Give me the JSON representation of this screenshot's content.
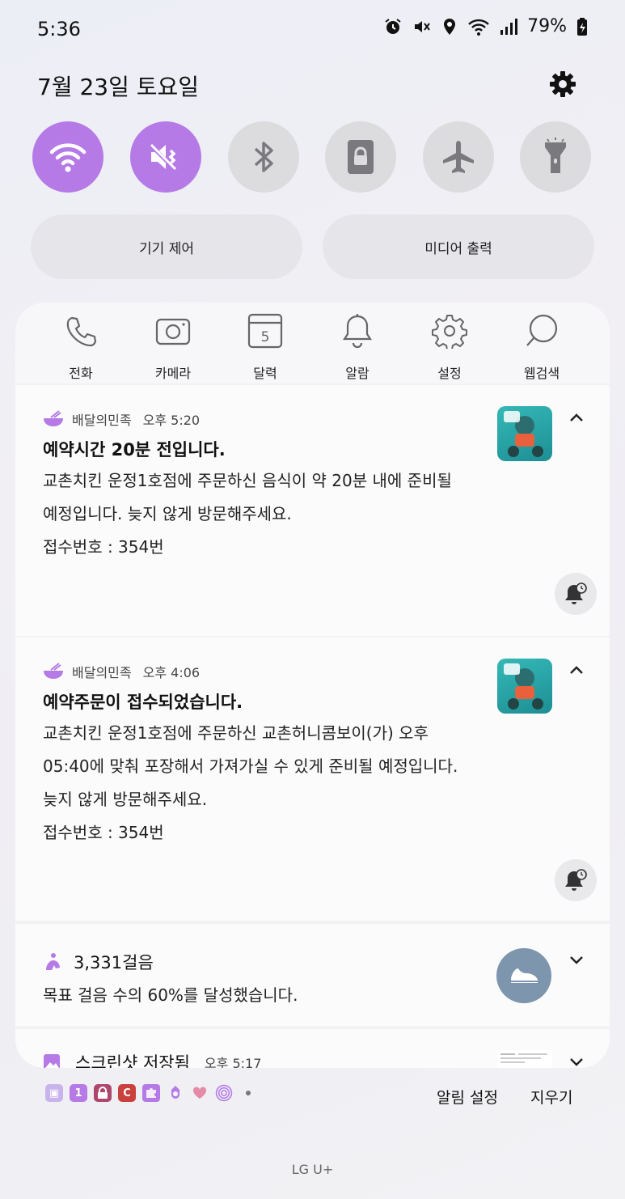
{
  "status_bar": {
    "time": "5:36",
    "battery": "79%",
    "icons": [
      "alarm-icon",
      "mute-icon",
      "location-icon",
      "wifi-icon",
      "signal-icon",
      "battery-icon"
    ]
  },
  "header": {
    "date": "7월 23일 토요일"
  },
  "quick_toggles": [
    {
      "name": "wifi",
      "icon": "wifi-icon",
      "state": "on"
    },
    {
      "name": "sound",
      "icon": "mute-icon",
      "state": "on"
    },
    {
      "name": "bluetooth",
      "icon": "bluetooth-icon",
      "state": "off"
    },
    {
      "name": "rotation-lock",
      "icon": "lock-icon",
      "state": "off"
    },
    {
      "name": "airplane",
      "icon": "airplane-icon",
      "state": "off"
    },
    {
      "name": "flashlight",
      "icon": "flashlight-icon",
      "state": "off"
    }
  ],
  "pills": {
    "device_control": "기기 제어",
    "media_output": "미디어 출력"
  },
  "shortcuts": [
    {
      "label": "전화",
      "icon": "phone-icon"
    },
    {
      "label": "카메라",
      "icon": "camera-icon"
    },
    {
      "label": "달력",
      "icon": "calendar-icon",
      "day": "5"
    },
    {
      "label": "알람",
      "icon": "bell-icon"
    },
    {
      "label": "설정",
      "icon": "gear-icon"
    },
    {
      "label": "웹검색",
      "icon": "search-icon"
    }
  ],
  "notifications": [
    {
      "app": "배달의민족",
      "time": "오후 5:20",
      "title": "예약시간 20분 전입니다.",
      "body_lines": [
        "교촌치킨 운정1호점에 주문하신 음식이 약 20분 내에 준비될",
        "예정입니다. 늦지 않게 방문해주세요.",
        "접수번호 : 354번"
      ]
    },
    {
      "app": "배달의민족",
      "time": "오후 4:06",
      "title": "예약주문이 접수되었습니다.",
      "body_lines": [
        "교촌치킨 운정1호점에 주문하신 교촌허니콤보이(가) 오후",
        "05:40에 맞춰 포장해서 가져가실 수 있게 준비될 예정입니다.",
        "늦지 않게 방문해주세요.",
        "접수번호 : 354번"
      ]
    }
  ],
  "steps": {
    "title": "3,331걸음",
    "body": "목표 걸음 수의 60%를 달성했습니다."
  },
  "screenshot": {
    "title": "스크린샷 저장됨",
    "time": "오후 5:17"
  },
  "bottom": {
    "notification_settings": "알림 설정",
    "clear_all": "지우기",
    "carrier": "LG U+"
  },
  "colors": {
    "accent": "#b57ae6",
    "toggle_off": "#dcdcde",
    "steps_badge": "#7d95ad"
  }
}
